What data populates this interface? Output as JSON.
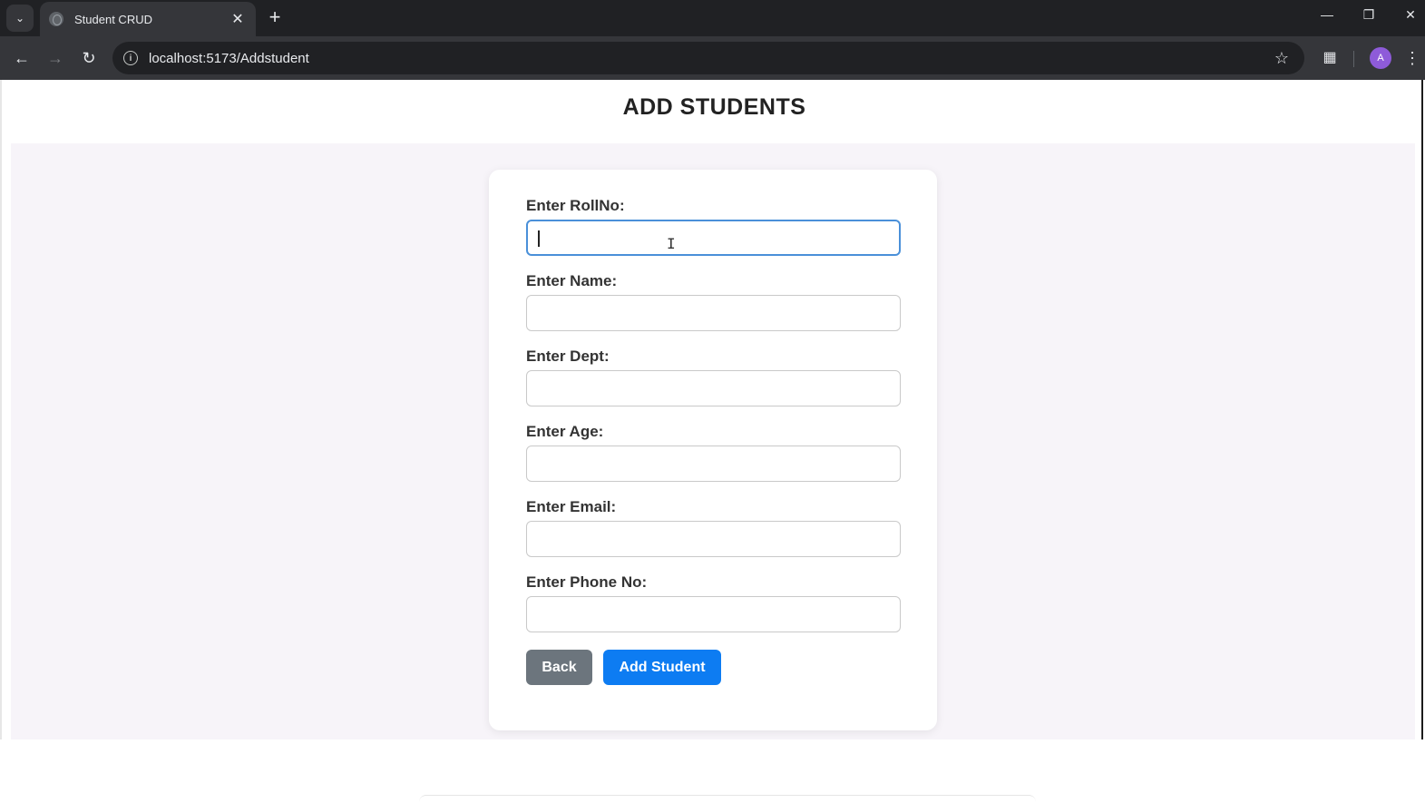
{
  "browser": {
    "tab_title": "Student CRUD",
    "url": "localhost:5173/Addstudent",
    "profile_initial": "A"
  },
  "page": {
    "title": "ADD STUDENTS"
  },
  "form": {
    "fields": [
      {
        "label": "Enter RollNo:",
        "value": "",
        "focused": true
      },
      {
        "label": "Enter Name:",
        "value": ""
      },
      {
        "label": "Enter Dept:",
        "value": ""
      },
      {
        "label": "Enter Age:",
        "value": ""
      },
      {
        "label": "Enter Email:",
        "value": ""
      },
      {
        "label": "Enter Phone No:",
        "value": ""
      }
    ],
    "back_label": "Back",
    "submit_label": "Add Student"
  },
  "colors": {
    "back_button": "#6c757d",
    "submit_button": "#0d7cf2",
    "focus_border": "#4a90d9",
    "page_background": "#f7f4f9"
  }
}
